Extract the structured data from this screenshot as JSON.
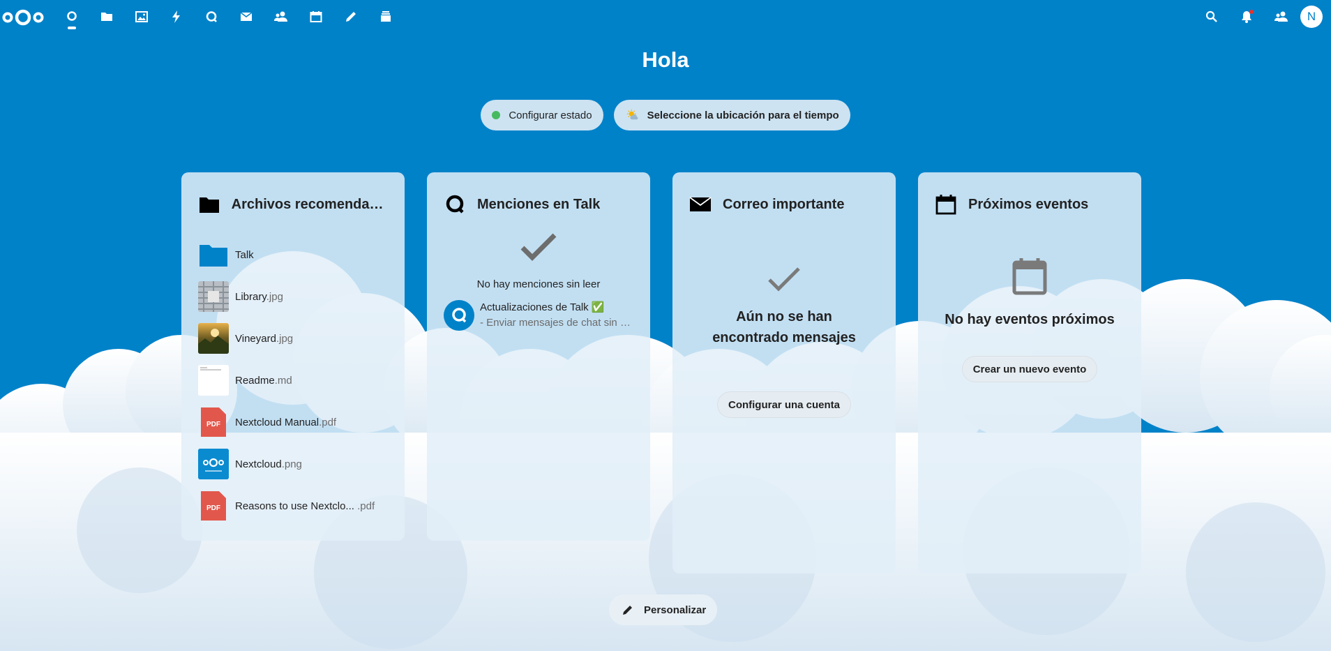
{
  "header": {
    "nav": [
      {
        "icon": "dashboard-icon",
        "label": "Panel"
      },
      {
        "icon": "files-icon",
        "label": "Archivos"
      },
      {
        "icon": "photos-icon",
        "label": "Fotos"
      },
      {
        "icon": "activity-icon",
        "label": "Actividad"
      },
      {
        "icon": "talk-icon",
        "label": "Talk"
      },
      {
        "icon": "mail-icon",
        "label": "Correo"
      },
      {
        "icon": "contacts-icon",
        "label": "Contactos"
      },
      {
        "icon": "calendar-icon",
        "label": "Calendario"
      },
      {
        "icon": "notes-icon",
        "label": "Notas"
      },
      {
        "icon": "deck-icon",
        "label": "Deck"
      }
    ],
    "avatar_initial": "N"
  },
  "greeting": "Hola",
  "status": {
    "set_status_label": "Configurar estado",
    "weather_label": "Seleccione la ubicación para el tiempo"
  },
  "panels": {
    "files": {
      "title": "Archivos recomendad...",
      "items": [
        {
          "name": "Talk",
          "ext": ""
        },
        {
          "name": "Library",
          "ext": ".jpg"
        },
        {
          "name": "Vineyard",
          "ext": ".jpg"
        },
        {
          "name": "Readme",
          "ext": ".md"
        },
        {
          "name": "Nextcloud Manual",
          "ext": ".pdf"
        },
        {
          "name": "Nextcloud",
          "ext": ".png"
        },
        {
          "name": "Reasons to use Nextclo...",
          "ext": " .pdf"
        }
      ]
    },
    "talk": {
      "title": "Menciones en Talk",
      "empty_text": "No hay menciones sin leer",
      "item_title": "Actualizaciones de Talk ✅",
      "item_subtitle": "- Enviar mensajes de chat sin n..."
    },
    "mail": {
      "title": "Correo importante",
      "empty_text": "Aún no se han encontrado mensajes",
      "button": "Configurar una cuenta"
    },
    "calendar": {
      "title": "Próximos eventos",
      "empty_text": "No hay eventos próximos",
      "button": "Crear un nuevo evento"
    }
  },
  "personalize_label": "Personalizar",
  "colors": {
    "primary": "#0082c9",
    "status_online": "#46ba61",
    "pdf_red": "#e2574c"
  }
}
